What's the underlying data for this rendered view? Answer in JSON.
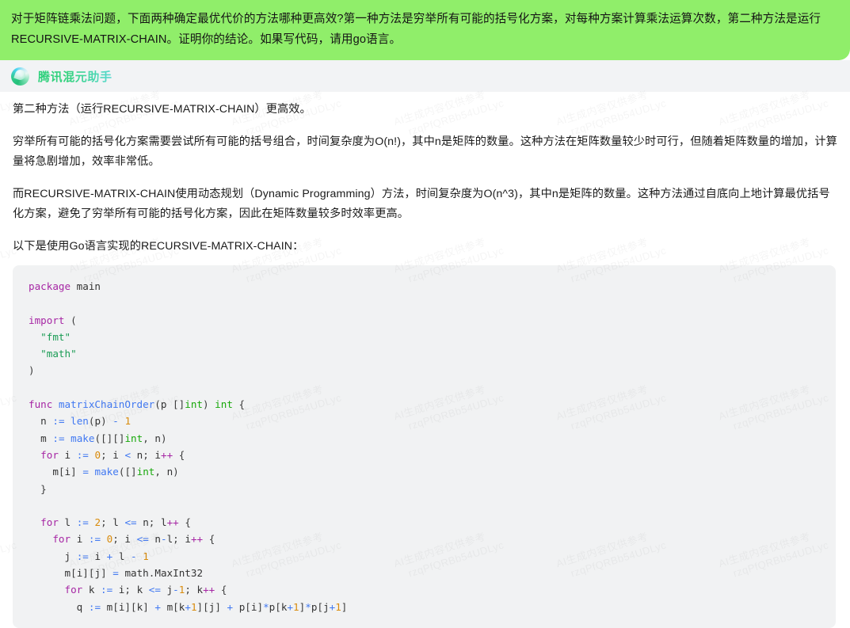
{
  "user_message": {
    "text": "对于矩阵链乘法问题，下面两种确定最优代价的方法哪种更高效?第一种方法是穷举所有可能的括号化方案，对每种方案计算乘法运算次数，第二种方法是运行RECURSIVE-MATRIX-CHAIN。证明你的结论。如果写代码，请用go语言。",
    "background_color": "#90ee6a"
  },
  "assistant": {
    "name": "腾讯混元助手",
    "logo_icon": "hunyuan-logo-icon",
    "name_gradient_start": "#2bd07a",
    "name_gradient_end": "#59d9d0",
    "band_background": "#f2f3f5"
  },
  "paragraphs": [
    "第二种方法（运行RECURSIVE-MATRIX-CHAIN）更高效。",
    "穷举所有可能的括号化方案需要尝试所有可能的括号组合，时间复杂度为O(n!)，其中n是矩阵的数量。这种方法在矩阵数量较少时可行，但随着矩阵数量的增加，计算量将急剧增加，效率非常低。",
    "而RECURSIVE-MATRIX-CHAIN使用动态规划（Dynamic Programming）方法，时间复杂度为O(n^3)，其中n是矩阵的数量。这种方法通过自底向上地计算最优括号化方案，避免了穷举所有可能的括号化方案，因此在矩阵数量较多时效率更高。",
    "以下是使用Go语言实现的RECURSIVE-MATRIX-CHAIN："
  ],
  "code_block": {
    "language": "go",
    "background_color": "#f1f2f3",
    "lines": [
      "package main",
      "",
      "import (",
      "  \"fmt\"",
      "  \"math\"",
      ")",
      "",
      "func matrixChainOrder(p []int) int {",
      "  n := len(p) - 1",
      "  m := make([][]int, n)",
      "  for i := 0; i < n; i++ {",
      "    m[i] = make([]int, n)",
      "  }",
      "",
      "  for l := 2; l <= n; l++ {",
      "    for i := 0; i <= n-l; i++ {",
      "      j := i + l - 1",
      "      m[i][j] = math.MaxInt32",
      "      for k := i; k <= j-1; k++ {",
      "        q := m[i][k] + m[k+1][j] + p[i]*p[k+1]*p[j+1]"
    ]
  },
  "watermark": {
    "line1": "AI生成内容仅供参考",
    "line2": "rzqPfQRBb54UDLyc"
  }
}
